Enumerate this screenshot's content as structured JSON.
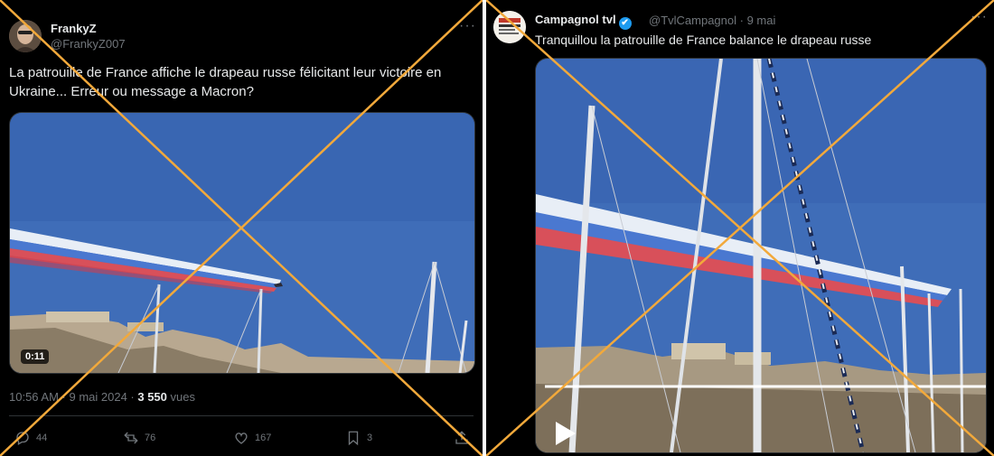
{
  "left_post": {
    "author_name": "FrankyZ",
    "author_handle": "@FrankyZ007",
    "more_label": "···",
    "text_line1": "La patrouille de France affiche le drapeau russe félicitant leur victoire en",
    "text_line2": "Ukraine... Erreur ou message a Macron?",
    "video_duration": "0:11",
    "timestamp": "10:56 AM · 9 mai 2024 · ",
    "views_count": "3 550",
    "views_label": " vues",
    "replies": "44",
    "reposts": "76",
    "likes": "167",
    "bookmarks": "3"
  },
  "right_post": {
    "author_name": "Campagnol tvl",
    "verified_icon": "✔",
    "author_handle": "@TvlCampagnol · 9 mai",
    "more_label": "···",
    "text": "Tranquillou la patrouille de France balance le drapeau russe"
  },
  "colors": {
    "cross_line": "#f2a93b",
    "sky": "#3f6db8",
    "smoke_blue": "#4a78d0",
    "smoke_red": "#d8505a"
  }
}
